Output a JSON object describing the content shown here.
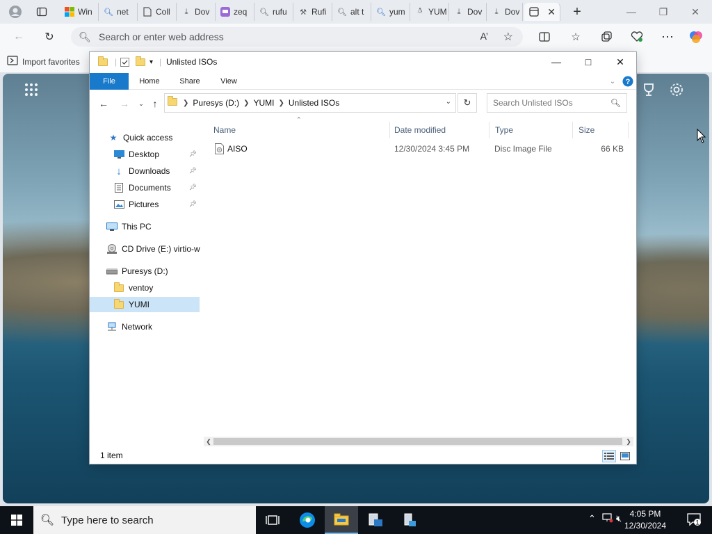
{
  "browser": {
    "tabs": [
      {
        "label": "Win",
        "icon": "windows-logo-icon"
      },
      {
        "label": "net",
        "icon": "search-icon"
      },
      {
        "label": "Coll",
        "icon": "page-icon"
      },
      {
        "label": "Dov",
        "icon": "download-icon"
      },
      {
        "label": "zeq",
        "icon": "chat-icon"
      },
      {
        "label": "rufu",
        "icon": "search-icon"
      },
      {
        "label": "Rufi",
        "icon": "tool-icon"
      },
      {
        "label": "alt t",
        "icon": "search-icon"
      },
      {
        "label": "yum",
        "icon": "search-icon"
      },
      {
        "label": "YUM",
        "icon": "penguin-icon"
      },
      {
        "label": "Dov",
        "icon": "download-icon"
      },
      {
        "label": "Dov",
        "icon": "download-icon"
      }
    ],
    "address_placeholder": "Search or enter web address",
    "favorites_bar": {
      "import_label": "Import favorites"
    }
  },
  "explorer": {
    "title": "Unlisted ISOs",
    "ribbon_tabs": [
      "File",
      "Home",
      "Share",
      "View"
    ],
    "breadcrumb": [
      "Puresys (D:)",
      "YUMI",
      "Unlisted ISOs"
    ],
    "search_placeholder": "Search Unlisted ISOs",
    "nav_pane": {
      "quick_access": "Quick access",
      "desktop": "Desktop",
      "downloads": "Downloads",
      "documents": "Documents",
      "pictures": "Pictures",
      "this_pc": "This PC",
      "cd_drive": "CD Drive (E:) virtio-w",
      "puresys": "Puresys (D:)",
      "ventoy": "ventoy",
      "yumi": "YUMI",
      "network": "Network"
    },
    "columns": {
      "name": "Name",
      "date": "Date modified",
      "type": "Type",
      "size": "Size"
    },
    "files": [
      {
        "name": "AISO",
        "date": "12/30/2024 3:45 PM",
        "type": "Disc Image File",
        "size": "66 KB"
      }
    ],
    "status": "1 item"
  },
  "taskbar": {
    "search_placeholder": "Type here to search",
    "time": "4:05 PM",
    "date": "12/30/2024",
    "notification_count": "1"
  },
  "colors": {
    "accent": "#1979ca",
    "taskbar": "#0d1118",
    "selection": "#cce4f7"
  }
}
